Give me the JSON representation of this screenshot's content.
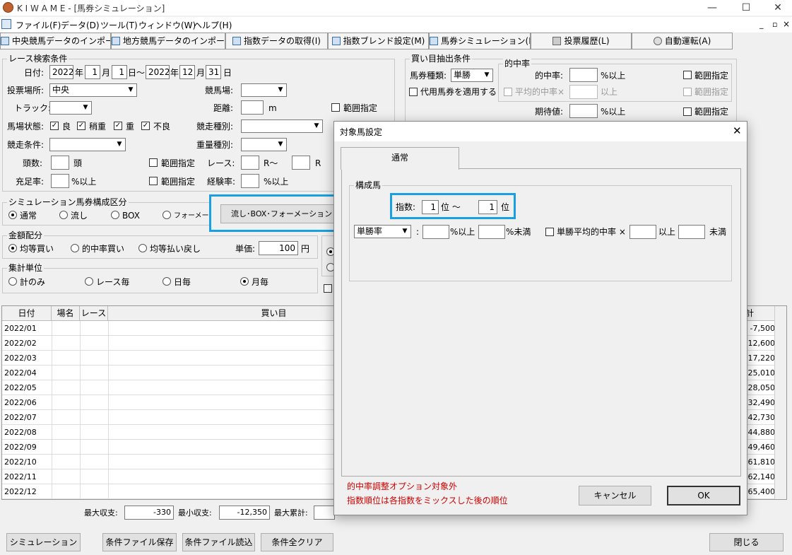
{
  "window": {
    "title": "K I W A M E - [馬券シミュレーション]",
    "min": "—",
    "max": "☐",
    "close": "✕"
  },
  "menu": [
    "ファイル(F)",
    "データ(D)",
    "ツール(T)",
    "ウィンドウ(W)",
    "ヘルプ(H)"
  ],
  "mdi": [
    "_",
    "▫",
    "×"
  ],
  "toolbar": [
    "中央競馬データのインポート(J)",
    "地方競馬データのインポート(N)",
    "指数データの取得(I)",
    "指数ブレンド設定(M)",
    "馬券シミュレーション(B)",
    "投票履歴(L)",
    "自動運転(A)"
  ],
  "race": {
    "title": "レース検索条件",
    "date_label": "日付:",
    "y1": "2022",
    "year": "年",
    "m1": "1",
    "month": "月",
    "d1": "1",
    "day_tilde": "日～",
    "y2": "2022",
    "m2": "12",
    "d2": "31",
    "day": "日",
    "venue_label": "投票場所:",
    "venue": "中央",
    "course_label": "競馬場:",
    "track_label": "トラック:",
    "dist_label": "距離:",
    "dist_unit": "m",
    "range": "範囲指定",
    "cond_label": "馬場状態:",
    "cond": [
      "良",
      "稍重",
      "重",
      "不良"
    ],
    "kind_label": "競走種別:",
    "cond2_label": "競走条件:",
    "weight_label": "重量種別:",
    "heads_label": "頭数:",
    "heads_unit": "頭",
    "race_label": "レース:",
    "r_tilde": "R～",
    "r": "R",
    "fill_label": "充足率:",
    "pct_above": "%以上",
    "exp_label": "経験率:"
  },
  "composition": {
    "title": "シミュレーション馬券構成区分",
    "options": [
      "通常",
      "流し",
      "BOX",
      "フォーメーション"
    ],
    "button": "流し･BOX･フォーメーション 対象"
  },
  "money": {
    "title": "金額配分",
    "options": [
      "均等買い",
      "的中率買い",
      "均等払い戻し"
    ],
    "unit_label": "単価:",
    "unit": "100",
    "yen": "円"
  },
  "agg": {
    "title": "集計単位",
    "options": [
      "計のみ",
      "レース毎",
      "日毎",
      "月毎"
    ]
  },
  "buy": {
    "title": "買い目抽出条件",
    "type_label": "馬券種類:",
    "type": "単勝",
    "substitute": "代用馬券を適用する",
    "hit_title": "的中率",
    "hit_label": "的中率:",
    "above": "%以上",
    "avg_label": "平均的中率×",
    "ijo": "以上",
    "exp_label": "期待値:",
    "range": "範囲指定"
  },
  "table": {
    "headers": [
      "日付",
      "場名",
      "レース",
      "買い目",
      "計"
    ],
    "rows": [
      {
        "date": "2022/01",
        "total": "-7,500"
      },
      {
        "date": "2022/02",
        "total": "-12,600"
      },
      {
        "date": "2022/03",
        "total": "-17,220"
      },
      {
        "date": "2022/04",
        "total": "-25,010"
      },
      {
        "date": "2022/05",
        "total": "-28,050"
      },
      {
        "date": "2022/06",
        "total": "-32,490"
      },
      {
        "date": "2022/07",
        "total": "-42,730"
      },
      {
        "date": "2022/08",
        "total": "-44,880"
      },
      {
        "date": "2022/09",
        "total": "-49,460"
      },
      {
        "date": "2022/10",
        "total": "-61,810"
      },
      {
        "date": "2022/11",
        "total": "-62,140"
      },
      {
        "date": "2022/12",
        "total": "-65,400"
      }
    ]
  },
  "stats": {
    "max_income_label": "最大収支:",
    "max_income": "-330",
    "min_income_label": "最小収支:",
    "min_income": "-12,350",
    "max_cum_label": "最大累計:"
  },
  "bottom": {
    "simulate": "シミュレーション",
    "save": "条件ファイル保存",
    "load": "条件ファイル読込",
    "clear": "条件全クリア",
    "close": "閉じる"
  },
  "dialog": {
    "title": "対象馬設定",
    "close": "✕",
    "tab": "通常",
    "group": "構成馬",
    "index_label": "指数:",
    "from": "1",
    "rank_tilde": "位 ～",
    "to": "1",
    "rank": "位",
    "ratio": "単勝率",
    "colon": ":",
    "pct_above": "%以上",
    "pct_below": "%未満",
    "avg_label": "単勝平均的中率 ×",
    "ijo": "以上",
    "miman": "未満",
    "note1": "的中率調整オプション対象外",
    "note2": "指数順位は各指数をミックスした後の順位",
    "cancel": "キャンセル",
    "ok": "OK"
  }
}
